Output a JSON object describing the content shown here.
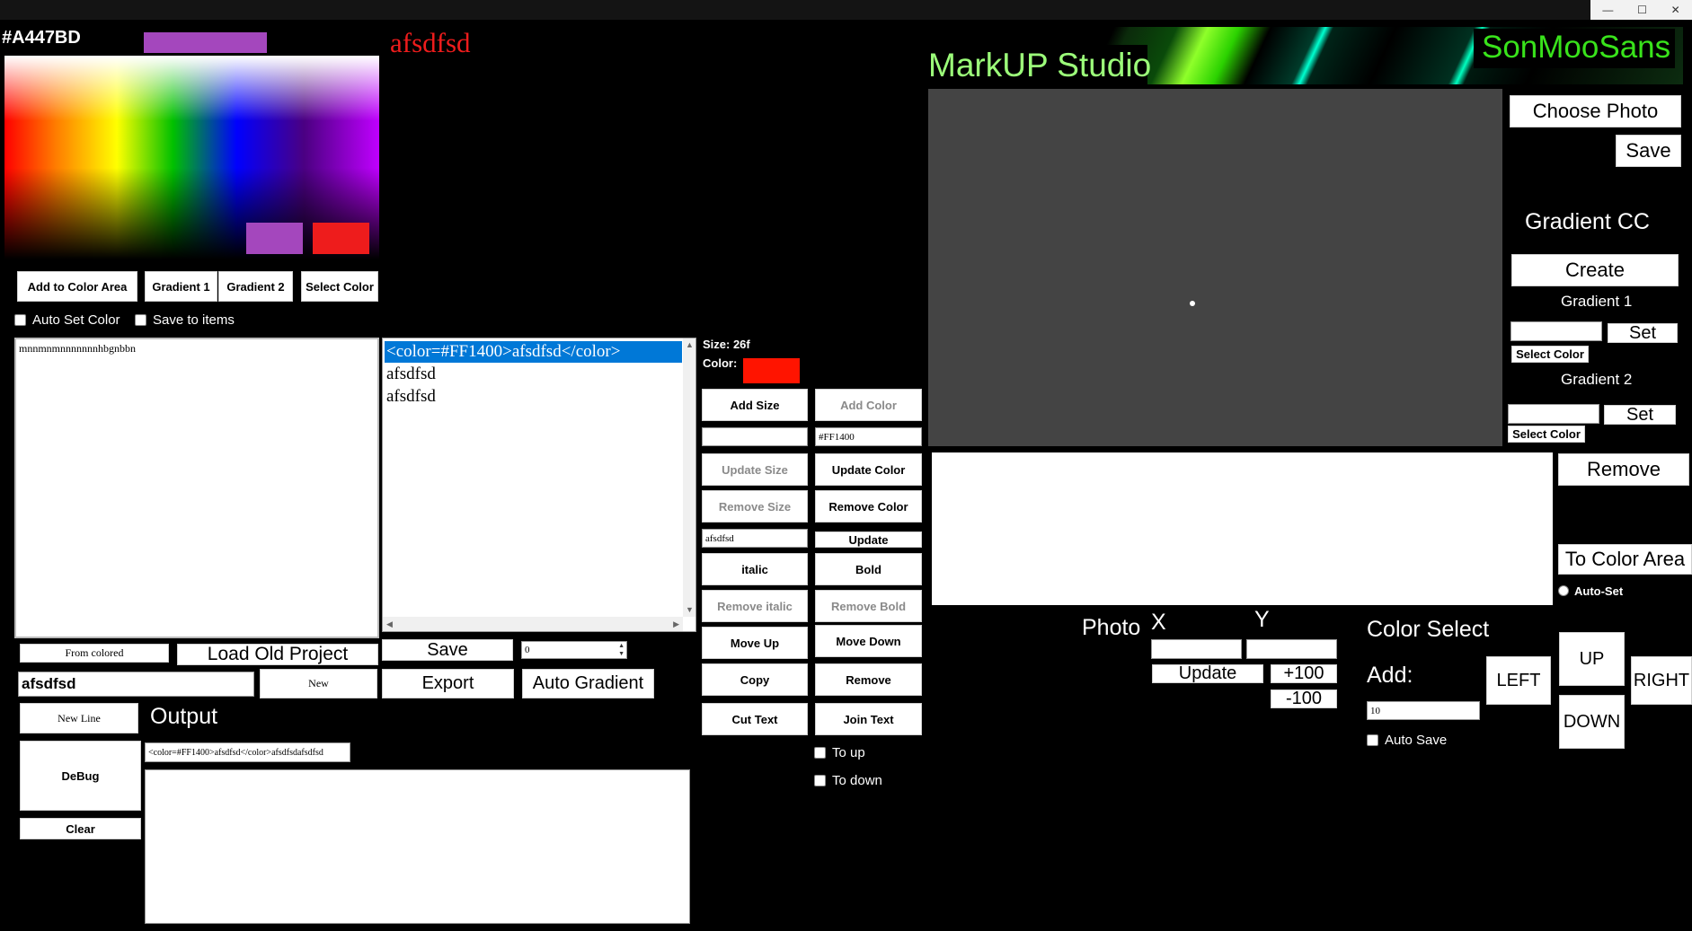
{
  "window": {
    "minimize_glyph": "—",
    "maximize_glyph": "☐",
    "close_glyph": "✕"
  },
  "picker": {
    "hex": "#A447BD",
    "current_color": "#A447BD",
    "slot1_color": "#A447BD",
    "slot2_color": "#EE1C1C",
    "preview_text": "afsdfsd",
    "preview_color": "#EE1C1C",
    "add_to_color_area": "Add to Color Area",
    "gradient1": "Gradient 1",
    "gradient2": "Gradient 2",
    "select_color": "Select Color",
    "auto_set_color": "Auto Set Color",
    "save_to_items": "Save to items"
  },
  "editor": {
    "text": "mnnmnmnnnnnnnhbgnbbn",
    "items": [
      "<color=#FF1400>afsdfsd</color>",
      "afsdfsd",
      "afsdfsd"
    ],
    "selected_index": 0,
    "from_colored": "From colored",
    "load_old_project": "Load Old Project",
    "save": "Save",
    "spin_value": "0",
    "name_value": "afsdfsd",
    "new": "New",
    "export": "Export",
    "auto_gradient": "Auto Gradient",
    "new_line": "New Line",
    "output_label": "Output",
    "debug": "DeBug",
    "output_line": "<color=#FF1400>afsdfsd</color>afsdfsdafsdfsd",
    "clear": "Clear"
  },
  "tools": {
    "size_label": "Size: 26f",
    "color_label": "Color:",
    "color_swatch": "#FF1400",
    "add_size": "Add Size",
    "add_color": "Add Color",
    "size_input": "",
    "color_input": "#FF1400",
    "update_size": "Update Size",
    "update_color": "Update Color",
    "remove_size": "Remove Size",
    "remove_color": "Remove Color",
    "text_input": "afsdfsd",
    "update": "Update",
    "italic": "italic",
    "bold": "Bold",
    "remove_italic": "Remove italic",
    "remove_bold": "Remove Bold",
    "move_up": "Move Up",
    "move_down": "Move Down",
    "copy": "Copy",
    "remove": "Remove",
    "cut_text": "Cut Text",
    "join_text": "Join Text",
    "to_up": "To up",
    "to_down": "To down"
  },
  "studio": {
    "title": "MarkUP Studio",
    "brand": "SonMooSans",
    "choose_photo": "Choose Photo",
    "save": "Save",
    "gradient_cc": "Gradient CC",
    "create": "Create",
    "gradient1": "Gradient 1",
    "gradient2": "Gradient 2",
    "set": "Set",
    "select_color": "Select Color",
    "gradient1_value": "",
    "gradient2_value": "",
    "remove": "Remove",
    "to_color_area": "To Color Area",
    "auto_set": "Auto-Set",
    "photo": "Photo",
    "x": "X",
    "y": "Y",
    "x_value": "",
    "y_value": "",
    "update": "Update",
    "plus100": "+100",
    "minus100": "-100",
    "color_select": "Color Select",
    "add": "Add:",
    "add_value": "10",
    "auto_save": "Auto Save",
    "left": "LEFT",
    "up": "UP",
    "right": "RIGHT",
    "down": "DOWN"
  }
}
